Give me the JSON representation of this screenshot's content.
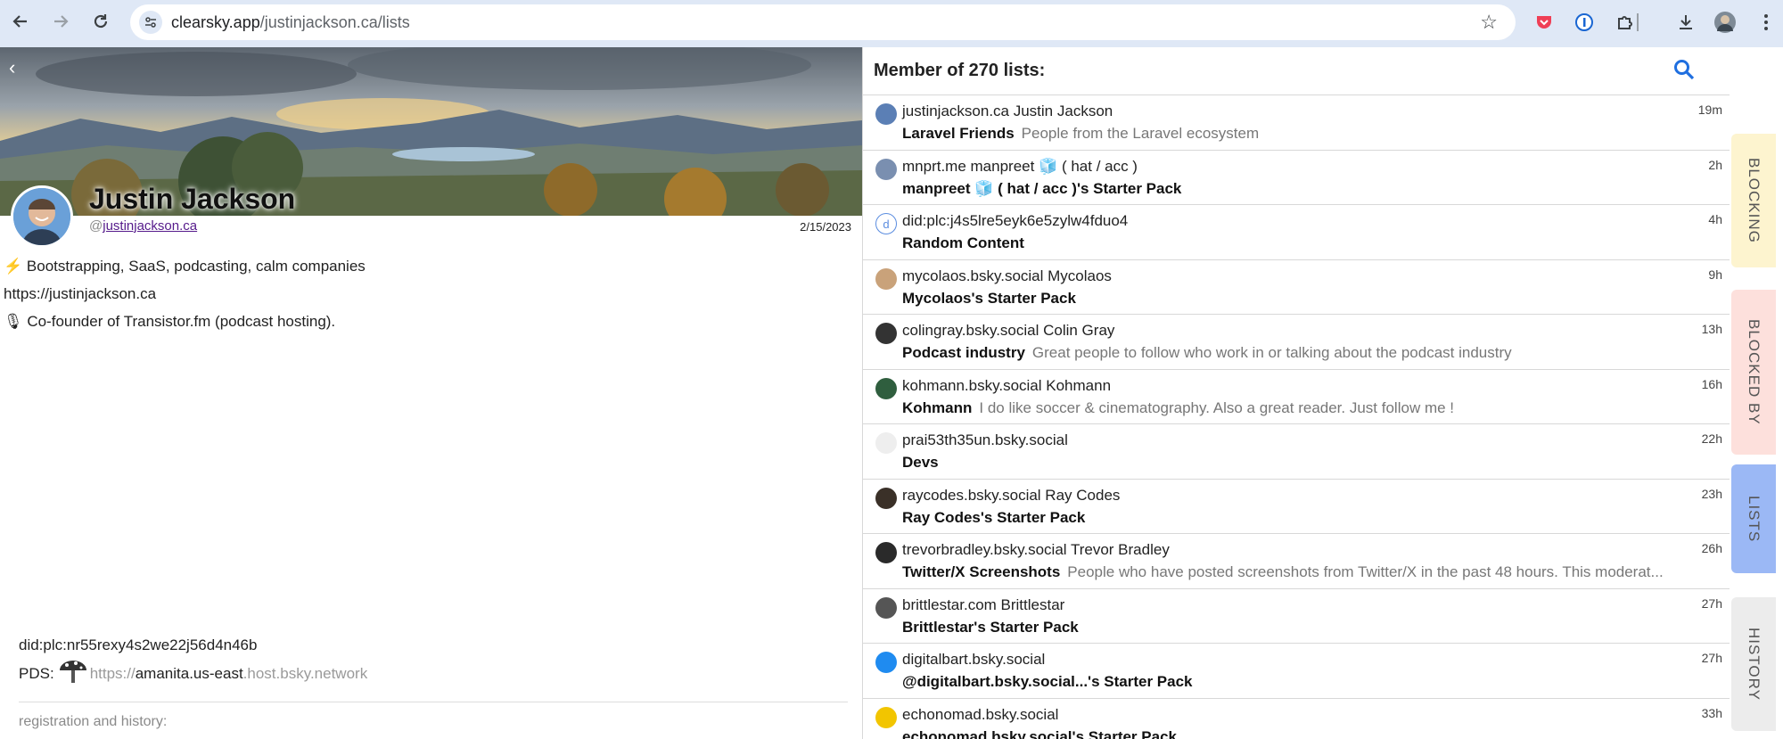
{
  "browser": {
    "url_domain": "clearsky.app",
    "url_path": "/justinjackson.ca/lists"
  },
  "profile": {
    "display_name": "Justin Jackson",
    "handle_prefix": "@",
    "handle": "justinjackson.ca",
    "joined": "2/15/2023",
    "bio": [
      {
        "icon": "⚡",
        "text": "Bootstrapping, SaaS, podcasting, calm companies"
      },
      {
        "icon": "",
        "text": "https://justinjackson.ca"
      },
      {
        "icon": "🎙",
        "text": "Co-founder of Transistor.fm (podcast hosting)."
      }
    ],
    "did": "did:plc:nr55rexy4s2we22j56d4n46b",
    "pds_label": "PDS:",
    "pds_proto": "https://",
    "pds_main": "amanita.us-east",
    "pds_host": ".host.bsky.network",
    "registration_label": "registration and history:"
  },
  "lists_panel": {
    "title": "Member of 270 lists:",
    "rows": [
      {
        "avatar_color": "#5b7fb5",
        "line1": "justinjackson.ca Justin Jackson",
        "name": "Laravel Friends",
        "desc": "People from the Laravel ecosystem",
        "time": "19m"
      },
      {
        "avatar_color": "#7a8fb0",
        "line1": "mnprt.me manpreet 🧊 ( hat / acc )",
        "name": "manpreet 🧊 ( hat / acc )'s Starter Pack",
        "desc": "",
        "time": "2h"
      },
      {
        "avatar_color": "#ffffff",
        "avatar_text": "d",
        "line1": "did:plc:j4s5lre5eyk6e5zylw4fduo4",
        "name": "Random Content",
        "desc": "",
        "time": "4h"
      },
      {
        "avatar_color": "#c9a27a",
        "line1": "mycolaos.bsky.social Mycolaos",
        "name": "Mycolaos's Starter Pack",
        "desc": "",
        "time": "9h"
      },
      {
        "avatar_color": "#333333",
        "line1": "colingray.bsky.social Colin Gray",
        "name": "Podcast industry",
        "desc": "Great people to follow who work in or talking about the podcast industry",
        "time": "13h"
      },
      {
        "avatar_color": "#2f5e3e",
        "line1": "kohmann.bsky.social Kohmann",
        "name": "Kohmann",
        "desc": "I do like soccer & cinematography. Also a great reader. Just follow me !",
        "time": "16h"
      },
      {
        "avatar_color": "#eeeeee",
        "line1": "prai53th35un.bsky.social",
        "name": "Devs",
        "desc": "",
        "time": "22h"
      },
      {
        "avatar_color": "#3a3028",
        "line1": "raycodes.bsky.social Ray Codes",
        "name": "Ray Codes's Starter Pack",
        "desc": "",
        "time": "23h"
      },
      {
        "avatar_color": "#2a2a2a",
        "line1": "trevorbradley.bsky.social Trevor Bradley",
        "name": "Twitter/X Screenshots",
        "desc": "People who have posted screenshots from Twitter/X in the past 48 hours. This moderat...",
        "time": "26h"
      },
      {
        "avatar_color": "#555555",
        "line1": "brittlestar.com Brittlestar",
        "name": "Brittlestar's Starter Pack",
        "desc": "",
        "time": "27h"
      },
      {
        "avatar_color": "#1f8bf0",
        "line1": "digitalbart.bsky.social",
        "name": "@digitalbart.bsky.social...'s Starter Pack",
        "desc": "",
        "time": "27h"
      },
      {
        "avatar_color": "#f2c500",
        "line1": "echonomad.bsky.social",
        "name": "echonomad.bsky.social's Starter Pack",
        "desc": "",
        "time": "33h"
      }
    ]
  },
  "tabs": [
    {
      "label": "BLOCKING",
      "color": "#fdf4cf"
    },
    {
      "label": "BLOCKED BY",
      "color": "#fde0dc"
    },
    {
      "label": "LISTS",
      "color": "#9bb8f5"
    },
    {
      "label": "HISTORY",
      "color": "#ececec"
    }
  ]
}
